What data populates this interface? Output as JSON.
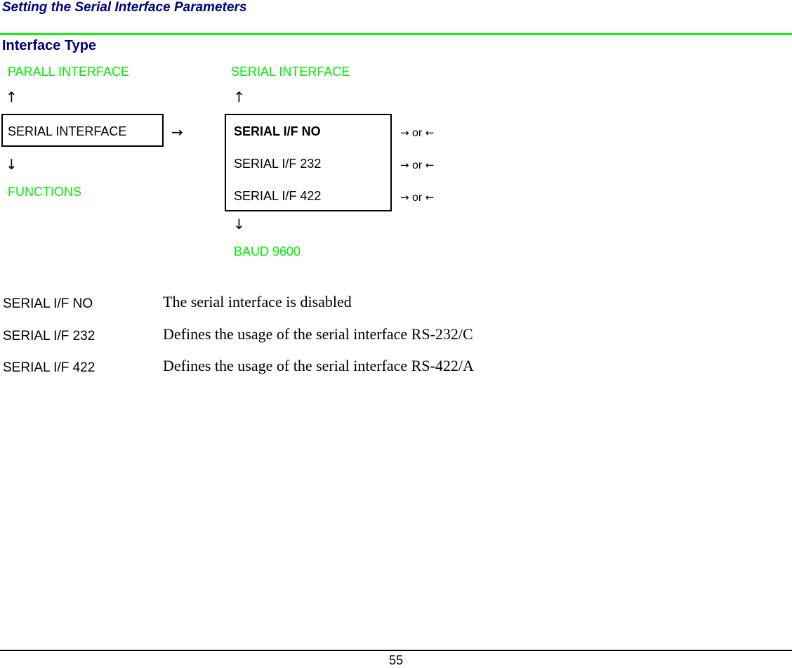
{
  "page": {
    "title": "Setting the Serial Interface Parameters",
    "section_title": "Interface Type",
    "page_number": "55"
  },
  "colors": {
    "heading": "#000080",
    "rule_accent": "#00ff00",
    "adjacent_menu_text": "#00ee00"
  },
  "diagram": {
    "left_column": {
      "above": "PARALL INTERFACE",
      "up_arrow": "↑",
      "current": "SERIAL INTERFACE",
      "down_arrow": "↓",
      "below": "FUNCTIONS"
    },
    "connector_arrow": "→",
    "right_column": {
      "above": "SERIAL INTERFACE",
      "up_arrow": "↑",
      "options": [
        {
          "label": "SERIAL I/F NO",
          "selected": true,
          "hint_right": "→",
          "hint_or": "or",
          "hint_left": "←"
        },
        {
          "label": "SERIAL I/F 232",
          "selected": false,
          "hint_right": "→",
          "hint_or": "or",
          "hint_left": "←"
        },
        {
          "label": "SERIAL I/F 422",
          "selected": false,
          "hint_right": "→",
          "hint_or": "or",
          "hint_left": "←"
        }
      ],
      "down_arrow": "↓",
      "below": "BAUD 9600"
    }
  },
  "definitions": [
    {
      "term": "SERIAL I/F NO",
      "description": "The serial interface is disabled"
    },
    {
      "term": "SERIAL I/F 232",
      "description": "Defines the usage of the serial interface RS-232/C"
    },
    {
      "term": "SERIAL I/F 422",
      "description": "Defines the usage of the serial interface RS-422/A"
    }
  ]
}
